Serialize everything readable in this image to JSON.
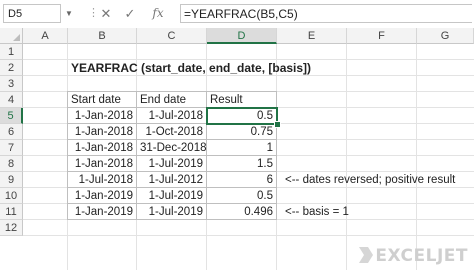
{
  "formula_bar": {
    "name_box": "D5",
    "formula": "=YEARFRAC(B5,C5)",
    "buttons": {
      "cancel": "✕",
      "enter": "✓",
      "function": "fx"
    }
  },
  "columns": [
    "A",
    "B",
    "C",
    "D",
    "E",
    "F",
    "G"
  ],
  "rows": [
    "1",
    "2",
    "3",
    "4",
    "5",
    "6",
    "7",
    "8",
    "9",
    "10",
    "11",
    "12"
  ],
  "active_cell": {
    "column": "D",
    "row": "5"
  },
  "sheet": {
    "title": "YEARFRAC (start_date, end_date, [basis])",
    "table_headers": {
      "start": "Start date",
      "end": "End date",
      "result": "Result"
    },
    "table_rows": [
      {
        "start": "1-Jan-2018",
        "end": "1-Jul-2018",
        "result": "0.5"
      },
      {
        "start": "1-Jan-2018",
        "end": "1-Oct-2018",
        "result": "0.75"
      },
      {
        "start": "1-Jan-2018",
        "end": "31-Dec-2018",
        "result": "1"
      },
      {
        "start": "1-Jan-2018",
        "end": "1-Jul-2019",
        "result": "1.5"
      },
      {
        "start": "1-Jul-2018",
        "end": "1-Jul-2012",
        "result": "6"
      },
      {
        "start": "1-Jan-2019",
        "end": "1-Jul-2019",
        "result": "0.5"
      },
      {
        "start": "1-Jan-2019",
        "end": "1-Jul-2019",
        "result": "0.496"
      }
    ],
    "notes": {
      "row9": "<-- dates reversed; positive result",
      "row11": "<-- basis = 1"
    }
  },
  "logo": {
    "text": "EXCELJET",
    "color": "#cfcfcf"
  },
  "colors": {
    "accent": "#217346",
    "header_bg": "#f3f3f3",
    "gridline": "#e3e3e3"
  }
}
